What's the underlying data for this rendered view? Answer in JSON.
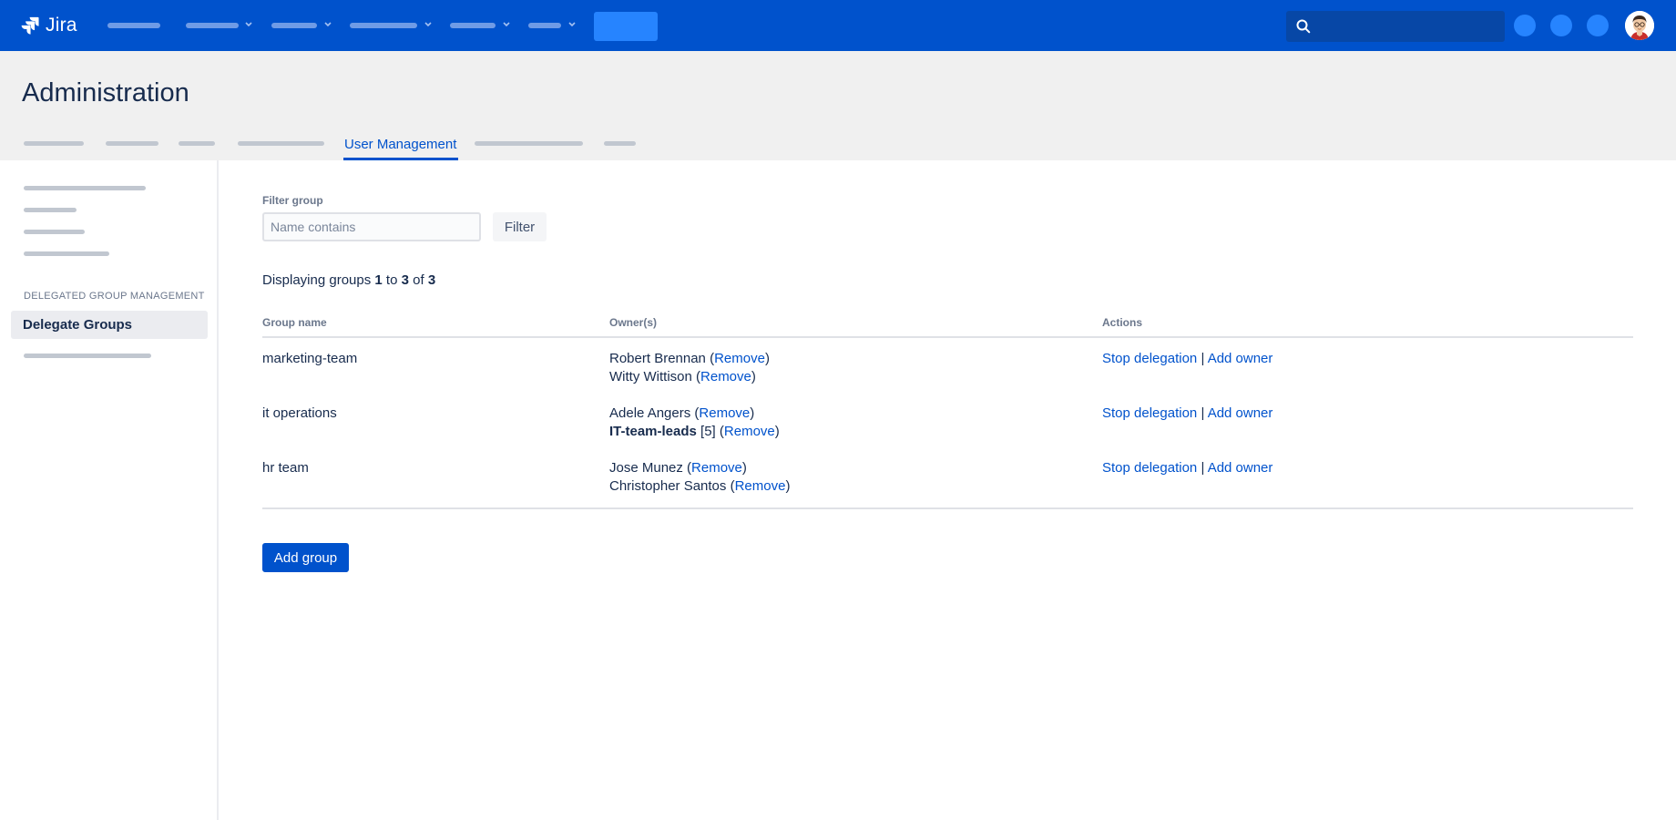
{
  "app": {
    "logo_text": "Jira"
  },
  "header": {
    "title": "Administration",
    "active_tab": "User Management"
  },
  "sidebar": {
    "section_label": "DELEGATED GROUP MANAGEMENT",
    "active_item": "Delegate Groups"
  },
  "filter": {
    "label": "Filter group",
    "placeholder": "Name contains",
    "button": "Filter"
  },
  "summary": {
    "prefix": "Displaying groups",
    "from": "1",
    "to_word": "to",
    "to": "3",
    "of_word": "of",
    "total": "3"
  },
  "table": {
    "headers": {
      "group": "Group name",
      "owners": "Owner(s)",
      "actions": "Actions"
    },
    "remove_label": "Remove",
    "stop_label": "Stop delegation",
    "add_owner_label": "Add owner",
    "separator": "|",
    "rows": [
      {
        "group": "marketing-team",
        "owners": [
          {
            "name": "Robert Brennan"
          },
          {
            "name": "Witty Wittison"
          }
        ]
      },
      {
        "group": "it operations",
        "owners": [
          {
            "name": "Adele Angers"
          },
          {
            "name": "IT-team-leads",
            "count": "[5]"
          }
        ]
      },
      {
        "group": "hr team",
        "owners": [
          {
            "name": "Jose Munez"
          },
          {
            "name": "Christopher Santos"
          }
        ]
      }
    ]
  },
  "add_group_button": "Add group",
  "colors": {
    "brand": "#0052cc",
    "link": "#0052cc",
    "nav_bg": "#0052cc",
    "header_bg": "#f0f0f0"
  }
}
